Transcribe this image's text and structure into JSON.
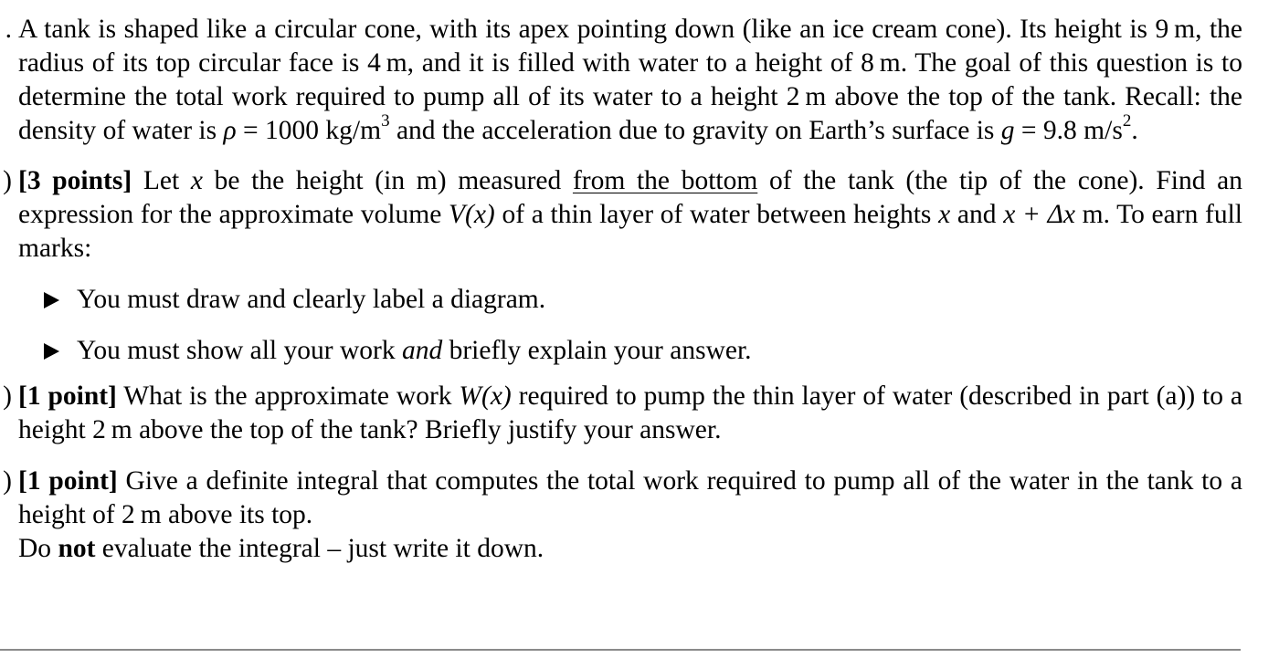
{
  "intro": {
    "marker": ".",
    "text_1": "A tank is shaped like a circular cone, with its apex pointing down (like an ice cream cone). Its height is 9 m, the radius of its top circular face is 4 m, and it is filled with water to a height of 8 m. The goal of this question is to determine the total work required to pump all of its water to a height 2 m above the top of the tank. Recall: the density of water is ",
    "rho_symbol": "ρ",
    "rho_value": " = 1000 kg/m",
    "rho_exp": "3",
    "text_2": " and the acceleration due to gravity on Earth’s surface is ",
    "g_symbol": "g",
    "g_value": " = 9.8 m/s",
    "g_exp": "2",
    "text_end": "."
  },
  "part_a": {
    "marker": ")",
    "points": "[3 points]",
    "text_1": " Let ",
    "var_x": "x",
    "text_2": " be the height (in m) measured ",
    "underlined": "from the bottom",
    "text_3": " of the tank (the tip of the cone). Find an expression for the approximate volume ",
    "vx": "V(x)",
    "text_4": " of a thin layer of water between heights ",
    "var_x2": "x",
    "text_5": " and ",
    "expr": "x + Δx",
    "text_6": " m. To earn full marks:",
    "bullets": [
      {
        "text": "You must draw and clearly label a diagram."
      },
      {
        "pre": "You must show all your work ",
        "em": "and",
        "post": " briefly explain your answer."
      }
    ]
  },
  "part_b": {
    "marker": ")",
    "points": "[1 point]",
    "text_1": " What is the approximate work ",
    "wx": "W(x)",
    "text_2": " required to pump the thin layer of water (described in part (a)) to a height 2 m above the top of the tank? Briefly justify your answer."
  },
  "part_c": {
    "marker": ")",
    "points": "[1 point]",
    "text_1": " Give a definite integral that computes the total work required to pump all of the water in the tank to a height of 2 m above its top.",
    "line2_pre": "Do ",
    "line2_bold": "not",
    "line2_post": " evaluate the integral – just write it down."
  }
}
